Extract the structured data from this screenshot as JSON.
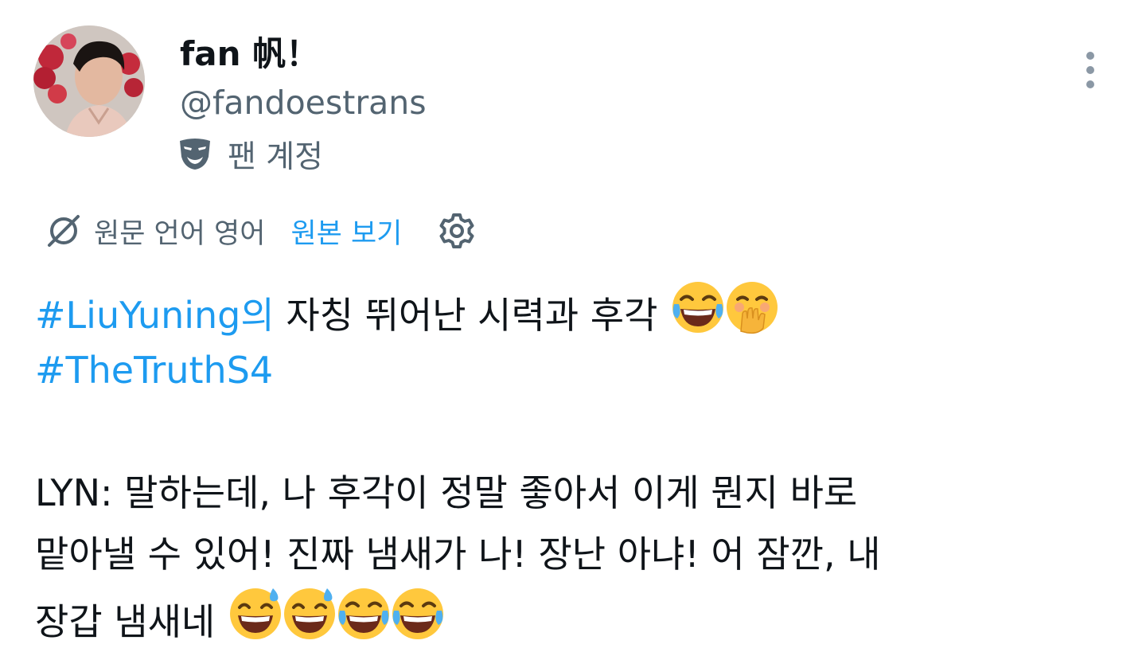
{
  "author": {
    "display_name": "fan 帆！",
    "handle": "@fandoestrans",
    "badge_icon": "theater-mask-icon",
    "badge_label": "팬 계정"
  },
  "menu": {
    "more_icon": "more-vertical-icon"
  },
  "translation": {
    "icon": "globe-slash-icon",
    "label": "원문 언어 영어",
    "show_original_label": "원본 보기",
    "settings_icon": "gear-icon"
  },
  "tweet": {
    "line1": {
      "hashtag": "#LiuYuning의",
      "text": " 자칭 뛰어난 시력과 후각 ",
      "emojis": [
        "face-with-tears-of-joy",
        "face-with-hand-over-mouth"
      ]
    },
    "line2": {
      "hashtag": "#TheTruthS4"
    },
    "line3": "LYN: 말하는데, 나 후각이 정말 좋아서 이게 뭔지 바로",
    "line4": "맡아낼 수 있어! 진짜 냄새가 나! 장난 아냐! 어 잠깐, 내",
    "line5": {
      "text": "장갑 냄새네 ",
      "emojis": [
        "grinning-face-with-sweat",
        "grinning-face-with-sweat",
        "face-with-tears-of-joy",
        "face-with-tears-of-joy"
      ]
    }
  },
  "colors": {
    "text_primary": "#0f1419",
    "text_secondary": "#536471",
    "link": "#1d9bf0"
  }
}
